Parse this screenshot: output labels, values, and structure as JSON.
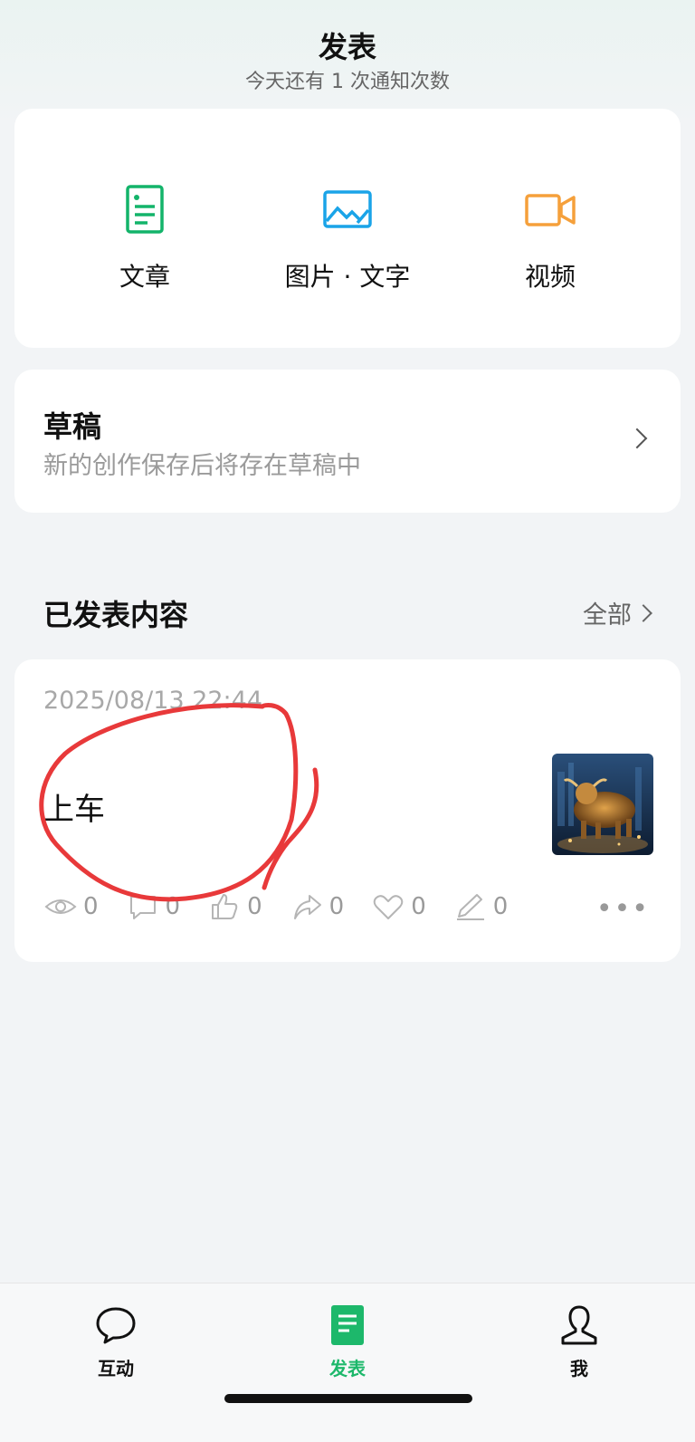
{
  "header": {
    "title": "发表",
    "subtitle": "今天还有 1 次通知次数"
  },
  "publish_types": [
    {
      "label": "文章",
      "icon": "article-icon",
      "color": "#13b46a"
    },
    {
      "label": "图片 · 文字",
      "icon": "image-text-icon",
      "color": "#1aa4e8"
    },
    {
      "label": "视频",
      "icon": "video-icon",
      "color": "#f5a03b"
    }
  ],
  "drafts": {
    "title": "草稿",
    "description": "新的创作保存后将存在草稿中"
  },
  "published": {
    "section_title": "已发表内容",
    "all_label": "全部",
    "posts": [
      {
        "date": "2025/08/13 22:44",
        "title": "上车",
        "thumbnail": "bull-statue-image",
        "stats": {
          "views": "0",
          "comments": "0",
          "likes": "0",
          "shares": "0",
          "favorites": "0",
          "edits": "0"
        }
      }
    ]
  },
  "tabbar": {
    "items": [
      {
        "label": "互动",
        "icon": "chat-bubble-icon"
      },
      {
        "label": "发表",
        "icon": "document-icon",
        "active": true
      },
      {
        "label": "我",
        "icon": "person-icon"
      }
    ]
  },
  "colors": {
    "accent": "#1db86b",
    "annotation": "#e8393a"
  }
}
